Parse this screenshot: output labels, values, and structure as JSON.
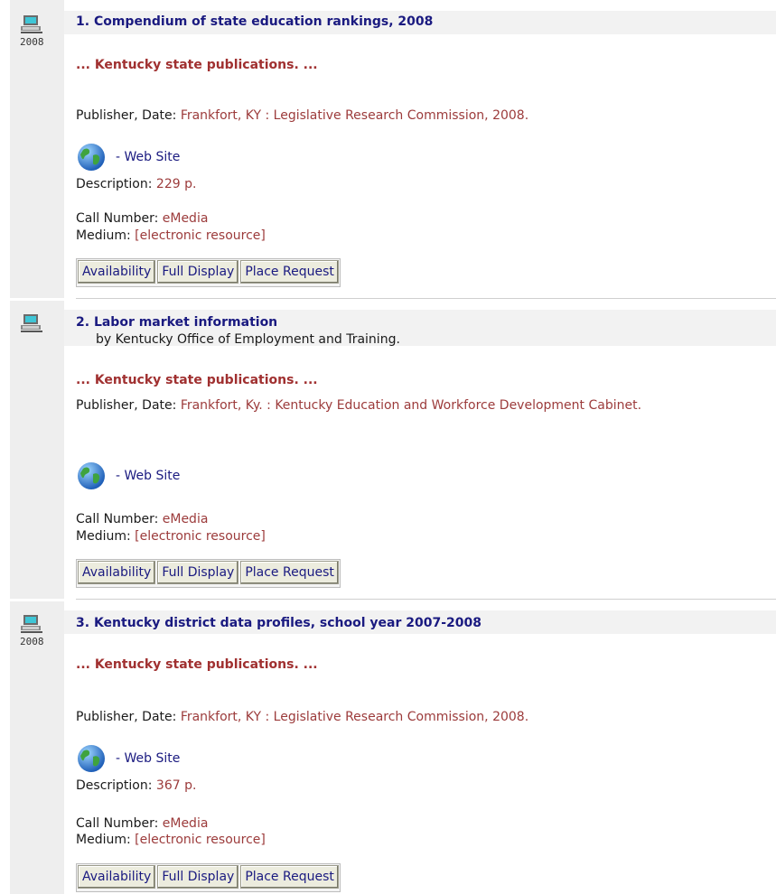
{
  "results": [
    {
      "number": "1.",
      "title": "Compendium of state education rankings, 2008",
      "year": "2008",
      "byline": "",
      "snippet_prefix": "... Kentucky state publications",
      "snippet_suffix": ". ...",
      "publisher_label": "Publisher, Date: ",
      "publisher": "Frankfort, KY : Legislative Research Commission, 2008.",
      "web_site": "- Web Site",
      "description_label": "Description: ",
      "description": "229 p.",
      "call_number_label": "Call Number: ",
      "call_number": "eMedia",
      "medium_label": "Medium: ",
      "medium": "[electronic resource]",
      "buttons": [
        "Availability",
        "Full Display",
        "Place Request"
      ]
    },
    {
      "number": "2.",
      "title": "Labor market information",
      "year": "",
      "byline": "by Kentucky Office of Employment and Training.",
      "snippet_prefix": "... Kentucky state publications",
      "snippet_suffix": ". ...",
      "publisher_label": "Publisher, Date: ",
      "publisher": "Frankfort, Ky. : Kentucky Education and Workforce Development Cabinet.",
      "web_site": "- Web Site",
      "description_label": "",
      "description": "",
      "call_number_label": "Call Number: ",
      "call_number": "eMedia",
      "medium_label": "Medium: ",
      "medium": "[electronic resource]",
      "buttons": [
        "Availability",
        "Full Display",
        "Place Request"
      ]
    },
    {
      "number": "3.",
      "title": "Kentucky district data profiles, school year 2007-2008",
      "year": "2008",
      "byline": "",
      "snippet_prefix": "... Kentucky state publications",
      "snippet_suffix": ". ...",
      "publisher_label": "Publisher, Date: ",
      "publisher": "Frankfort, KY : Legislative Research Commission, 2008.",
      "web_site": "- Web Site",
      "description_label": "Description: ",
      "description": "367 p.",
      "call_number_label": "Call Number: ",
      "call_number": "eMedia",
      "medium_label": "Medium: ",
      "medium": "[electronic resource]",
      "buttons": [
        "Availability",
        "Full Display",
        "Place Request"
      ]
    }
  ],
  "icons": {
    "format": "computer-icon",
    "link": "globe-icon"
  },
  "colors": {
    "title": "#1a1a80",
    "value": "#9c3b3b",
    "snippet": "#a03030",
    "gutter": "#eeeeee"
  }
}
